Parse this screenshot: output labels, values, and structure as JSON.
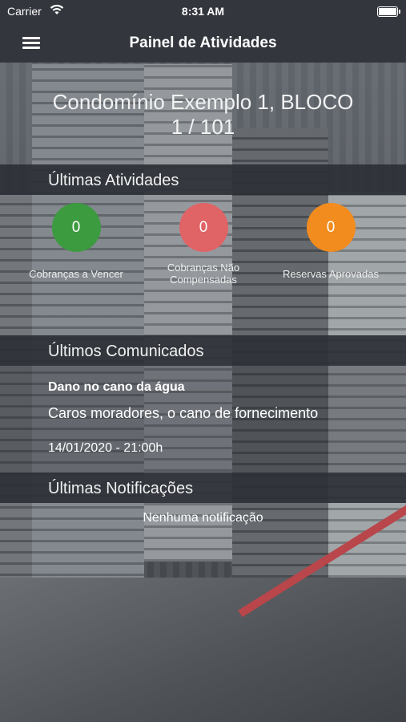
{
  "status_bar": {
    "carrier": "Carrier",
    "time": "8:31 AM",
    "battery": 1.0
  },
  "nav": {
    "title": "Painel de Atividades",
    "menu_icon": "hamburger-menu-icon"
  },
  "condo": {
    "line1": "Condomínio Exemplo 1, BLOCO",
    "line2": "1 / 101"
  },
  "sections": {
    "activities": "Últimas Atividades",
    "communications": "Últimos Comunicados",
    "notifications": "Últimas Notificações"
  },
  "stats": [
    {
      "value": "0",
      "label": "Cobranças a Vencer",
      "color": "#3c9a3f"
    },
    {
      "value": "0",
      "label": "Cobranças Não Compensadas",
      "color": "#e06366"
    },
    {
      "value": "0",
      "label": "Reservas Aprovadas",
      "color": "#f28c1e"
    }
  ],
  "communication": {
    "title": "Dano no cano da água",
    "body": "Caros moradores, o cano de fornecimento",
    "date": "14/01/2020 - 21:00h"
  },
  "notifications": {
    "empty": "Nenhuma notificação"
  }
}
